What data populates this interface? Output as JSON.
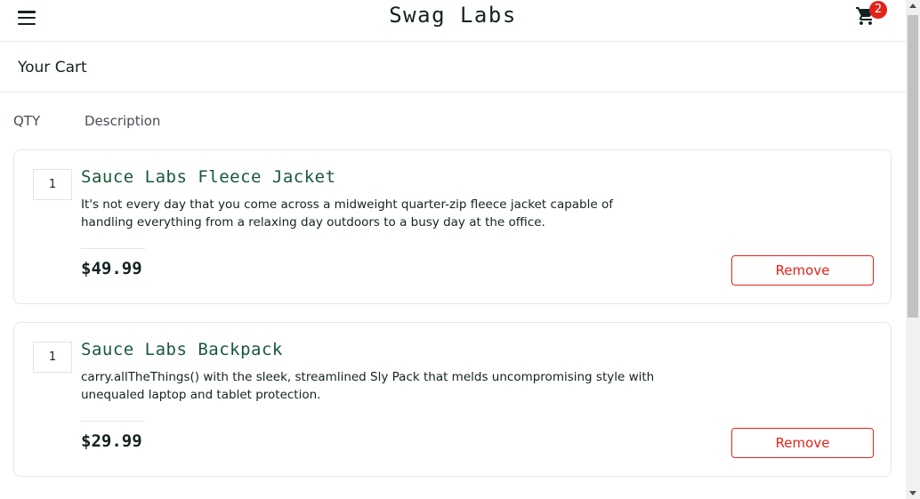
{
  "header": {
    "logo": "Swag Labs",
    "cart_count": "2",
    "menu_icon": "hamburger-menu-icon",
    "cart_icon": "shopping-cart-icon"
  },
  "page": {
    "title": "Your Cart"
  },
  "columns": {
    "qty": "QTY",
    "description": "Description"
  },
  "cart_items": [
    {
      "quantity": "1",
      "name": "Sauce Labs Fleece Jacket",
      "description": "It's not every day that you come across a midweight quarter-zip fleece jacket capable of handling everything from a relaxing day outdoors to a busy day at the office.",
      "price": "$49.99",
      "remove_label": "Remove"
    },
    {
      "quantity": "1",
      "name": "Sauce Labs Backpack",
      "description": "carry.allTheThings() with the sleek, streamlined Sly Pack that melds uncompromising style with unequaled laptop and tablet protection.",
      "price": "$29.99",
      "remove_label": "Remove"
    }
  ],
  "colors": {
    "brand_text": "#132322",
    "item_name": "#18583a",
    "remove_accent": "#e2231a",
    "badge": "#e2231a",
    "border": "#e6e6e6"
  }
}
